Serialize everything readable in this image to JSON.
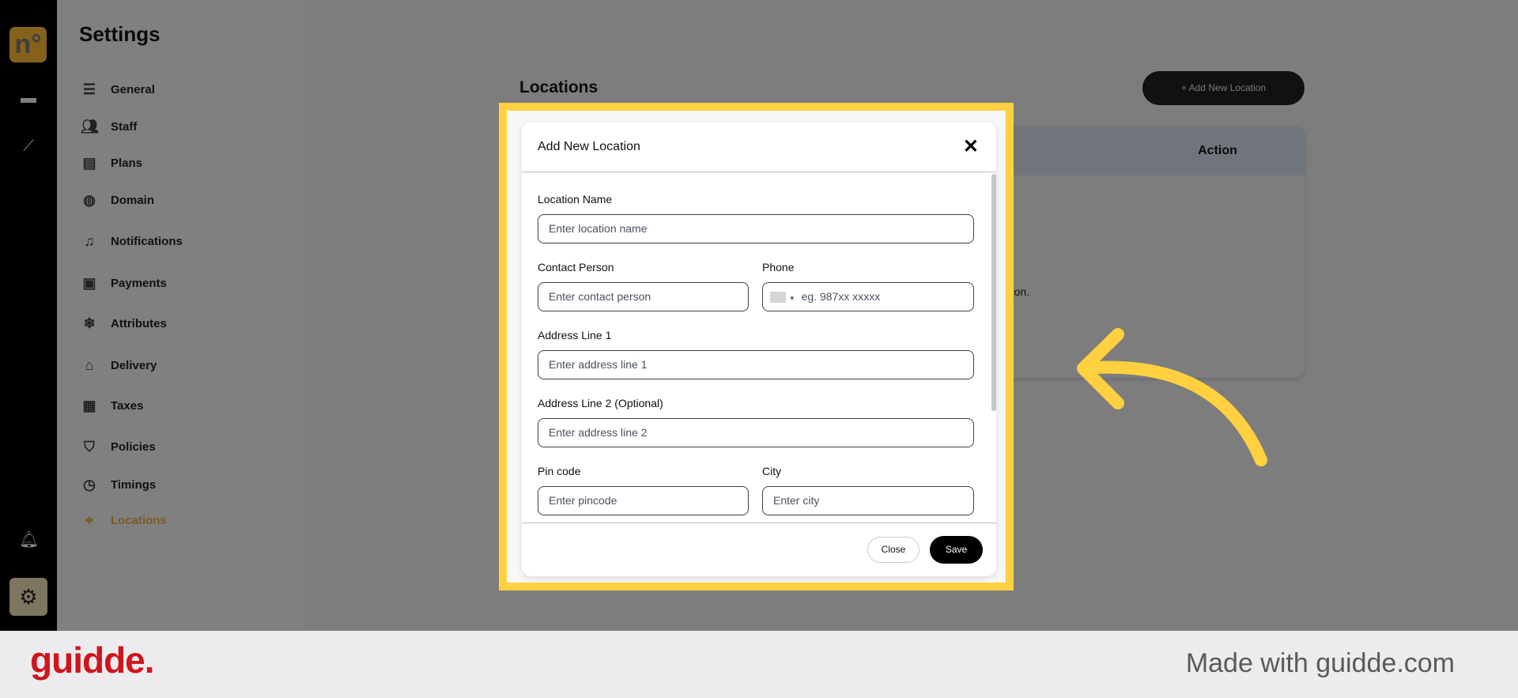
{
  "rail": {
    "logo": "n°",
    "icons": [
      "store-icon",
      "chart-icon",
      "bell-icon",
      "gear-icon"
    ]
  },
  "settings": {
    "title": "Settings",
    "items": [
      {
        "label": "General",
        "icon": "sliders-icon"
      },
      {
        "label": "Staff",
        "icon": "users-icon"
      },
      {
        "label": "Plans",
        "icon": "plans-icon"
      },
      {
        "label": "Domain",
        "icon": "globe-icon"
      },
      {
        "label": "Notifications",
        "icon": "bell-icon"
      },
      {
        "label": "Payments",
        "icon": "wallet-icon"
      },
      {
        "label": "Attributes",
        "icon": "snowflake-icon"
      },
      {
        "label": "Delivery",
        "icon": "bag-icon"
      },
      {
        "label": "Taxes",
        "icon": "receipt-icon"
      },
      {
        "label": "Policies",
        "icon": "shield-icon"
      },
      {
        "label": "Timings",
        "icon": "clock-icon"
      },
      {
        "label": "Locations",
        "icon": "location-icon",
        "active": true
      }
    ]
  },
  "main": {
    "title": "Locations",
    "add_button": "+ Add New Location",
    "table_header_action": "Action",
    "empty_fragment": "cation."
  },
  "modal": {
    "title": "Add New Location",
    "fields": {
      "location_name": {
        "label": "Location Name",
        "placeholder": "Enter location name"
      },
      "contact_person": {
        "label": "Contact Person",
        "placeholder": "Enter contact person"
      },
      "phone": {
        "label": "Phone",
        "placeholder": "eg. 987xx xxxxx"
      },
      "address1": {
        "label": "Address Line 1",
        "placeholder": "Enter address line 1"
      },
      "address2": {
        "label": "Address Line 2 (Optional)",
        "placeholder": "Enter address line 2"
      },
      "pincode": {
        "label": "Pin code",
        "placeholder": "Enter pincode"
      },
      "city": {
        "label": "City",
        "placeholder": "Enter city"
      }
    },
    "close_label": "Close",
    "save_label": "Save"
  },
  "footer": {
    "brand": "guidde.",
    "made_with": "Made with guidde.com"
  },
  "colors": {
    "highlight": "#ffd03f",
    "active": "#b8862f",
    "brand": "#d0141c"
  }
}
